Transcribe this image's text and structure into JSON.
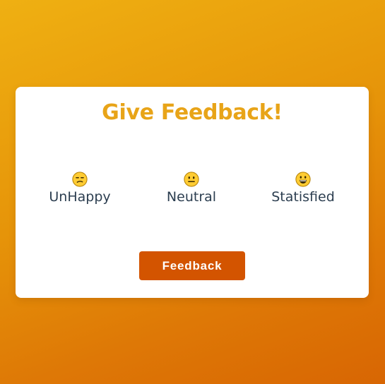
{
  "card": {
    "title": "Give Feedback!"
  },
  "options": [
    {
      "label": "UnHappy",
      "icon": "unamused-face-icon"
    },
    {
      "label": "Neutral",
      "icon": "neutral-face-icon"
    },
    {
      "label": "Statisfied",
      "icon": "grinning-face-icon"
    }
  ],
  "submit": {
    "label": "Feedback"
  },
  "colors": {
    "accent": "#D35400",
    "title": "#E8A418",
    "text": "#2C3E50",
    "background_top": "#EFB012",
    "background_bottom": "#D86603"
  }
}
